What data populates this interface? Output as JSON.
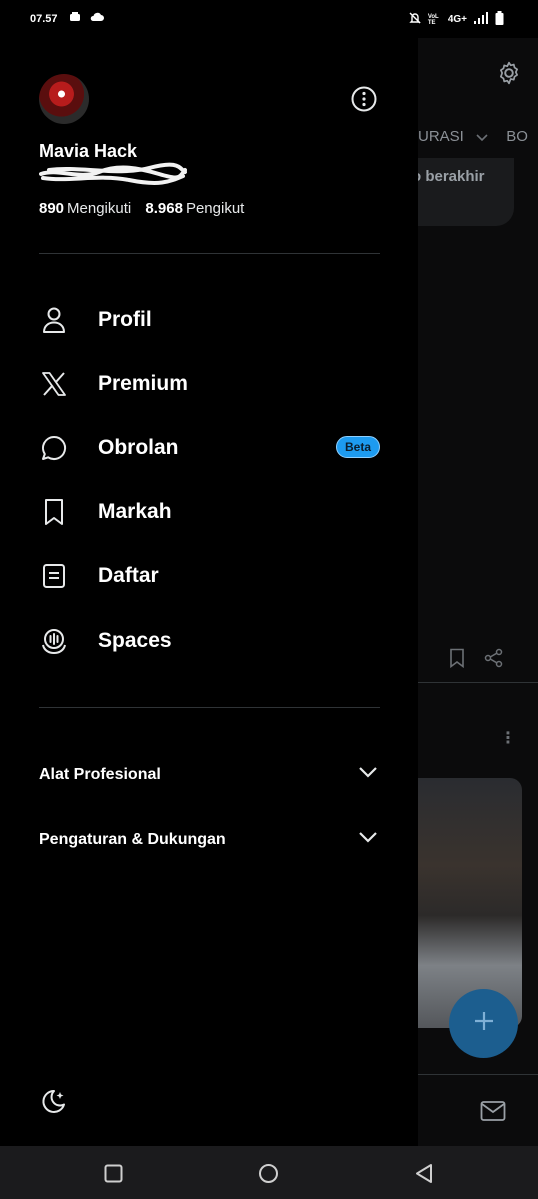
{
  "status_bar": {
    "time": "07.57",
    "network_label": "4G+",
    "volte_label": "VoLTE",
    "icons": [
      "app-icon",
      "cloud-icon",
      "mute-icon",
      "signal-icon",
      "battery-icon"
    ]
  },
  "drawer": {
    "profile": {
      "name": "Mavia Hack",
      "following_count": "890",
      "following_label": "Mengikuti",
      "followers_count": "8.968",
      "followers_label": "Pengikut"
    },
    "menu": [
      {
        "label": "Profil",
        "icon": "person-icon"
      },
      {
        "label": "Premium",
        "icon": "x-logo-icon"
      },
      {
        "label": "Obrolan",
        "icon": "chat-bubble-icon",
        "badge": "Beta"
      },
      {
        "label": "Markah",
        "icon": "bookmark-icon"
      },
      {
        "label": "Daftar",
        "icon": "list-icon"
      },
      {
        "label": "Spaces",
        "icon": "spaces-icon"
      }
    ],
    "sections": [
      {
        "label": "Alat Profesional"
      },
      {
        "label": "Pengaturan & Dukungan"
      }
    ]
  },
  "background": {
    "tab_partial": "URASI",
    "tab_partial_2": "BO",
    "card_text_partial": "o berakhir"
  },
  "colors": {
    "accent": "#1d9bf0",
    "fab": "#1c5e8f",
    "background": "#000000"
  }
}
